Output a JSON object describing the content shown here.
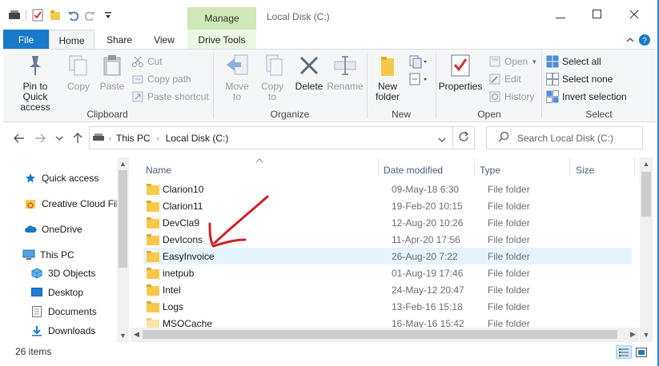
{
  "window": {
    "title": "Local Disk (C:)",
    "context_tab": "Manage"
  },
  "colors": {
    "accent": "#1979ca",
    "manage_tab": "#cfe8b7",
    "selection": "#e5f3ff",
    "folder": "#f6c94a",
    "annotation": "#d0202a"
  },
  "ribbon_tabs": [
    "File",
    "Home",
    "Share",
    "View",
    "Drive Tools"
  ],
  "ribbon": {
    "clipboard": {
      "label": "Clipboard",
      "pin": "Pin to Quick access",
      "copy": "Copy",
      "paste": "Paste",
      "cut": "Cut",
      "copy_path": "Copy path",
      "paste_shortcut": "Paste shortcut"
    },
    "organize": {
      "label": "Organize",
      "move_to": "Move to",
      "copy_to": "Copy to",
      "delete": "Delete",
      "rename": "Rename"
    },
    "new": {
      "label": "New",
      "new_folder": "New folder"
    },
    "open": {
      "label": "Open",
      "properties": "Properties",
      "open": "Open",
      "edit": "Edit",
      "history": "History"
    },
    "select": {
      "label": "Select",
      "select_all": "Select all",
      "select_none": "Select none",
      "invert_selection": "Invert selection"
    }
  },
  "address": {
    "crumbs": [
      "This PC",
      "Local Disk (C:)"
    ],
    "search_placeholder": "Search Local Disk (C:)"
  },
  "nav_pane": [
    {
      "label": "Quick access",
      "icon": "star-icon"
    },
    {
      "label": "Creative Cloud Fil",
      "icon": "creative-cloud-icon"
    },
    {
      "label": "OneDrive",
      "icon": "cloud-icon"
    },
    {
      "label": "This PC",
      "icon": "computer-icon"
    },
    {
      "label": "3D Objects",
      "icon": "cube-icon"
    },
    {
      "label": "Desktop",
      "icon": "desktop-icon"
    },
    {
      "label": "Documents",
      "icon": "document-icon"
    },
    {
      "label": "Downloads",
      "icon": "download-icon"
    }
  ],
  "columns": {
    "name": "Name",
    "date": "Date modified",
    "type": "Type",
    "size": "Size"
  },
  "files": [
    {
      "name": "Clarion10",
      "date": "09-May-18 6:30",
      "type": "File folder"
    },
    {
      "name": "Clarion11",
      "date": "19-Feb-20 10:15",
      "type": "File folder"
    },
    {
      "name": "DevCla9",
      "date": "12-Aug-20 10:26",
      "type": "File folder"
    },
    {
      "name": "DevIcons",
      "date": "11-Apr-20 17:56",
      "type": "File folder"
    },
    {
      "name": "EasyInvoice",
      "date": "26-Aug-20 7:22",
      "type": "File folder"
    },
    {
      "name": "inetpub",
      "date": "01-Aug-19 17:46",
      "type": "File folder"
    },
    {
      "name": "Intel",
      "date": "24-May-12 20:47",
      "type": "File folder"
    },
    {
      "name": "Logs",
      "date": "13-Feb-16 15:18",
      "type": "File folder"
    },
    {
      "name": "MSOCache",
      "date": "16-May-16 15:42",
      "type": "File folder"
    }
  ],
  "status": {
    "item_count": "26 items"
  }
}
